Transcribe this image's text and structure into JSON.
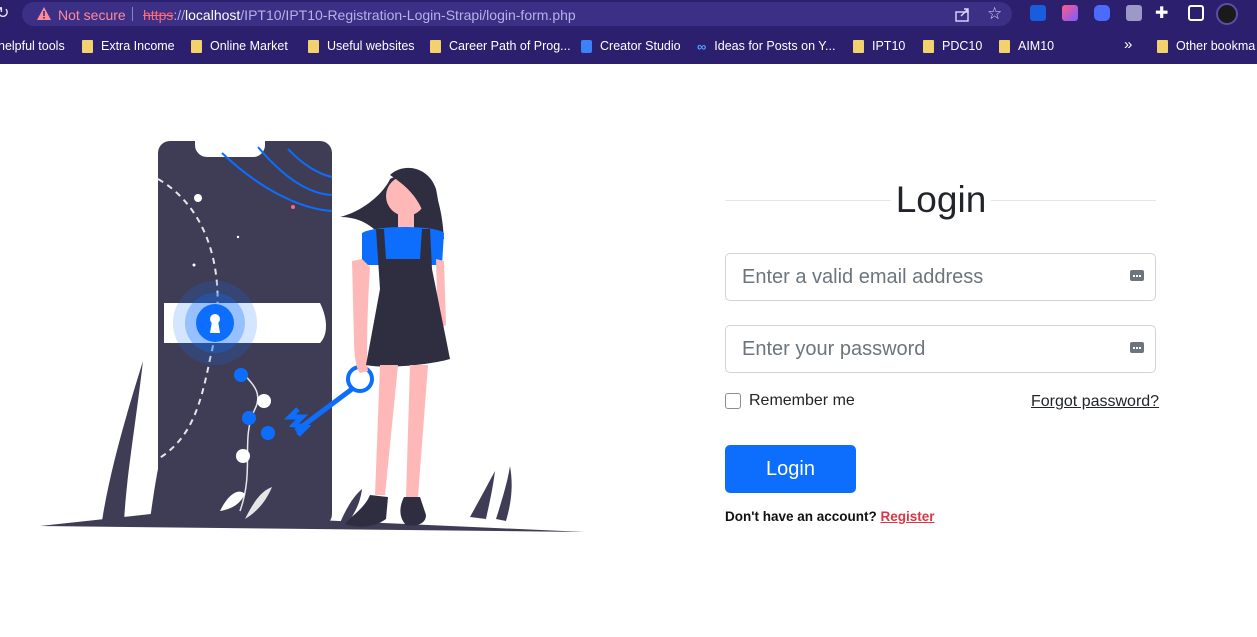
{
  "browser": {
    "security_label": "Not secure",
    "url_scheme": "https",
    "url_sep": "://",
    "url_host": "localhost",
    "url_path": "/IPT10/IPT10-Registration-Login-Strapi/login-form.php"
  },
  "bookmarks": {
    "items": [
      {
        "label": "helpful tools"
      },
      {
        "label": "Extra Income"
      },
      {
        "label": "Online Market"
      },
      {
        "label": "Useful websites"
      },
      {
        "label": "Career Path of Prog..."
      },
      {
        "label": "Creator Studio"
      },
      {
        "label": "Ideas for Posts on Y..."
      },
      {
        "label": "IPT10"
      },
      {
        "label": "PDC10"
      },
      {
        "label": "AIM10"
      }
    ],
    "more": "»",
    "other": "Other bookma"
  },
  "login": {
    "title": "Login",
    "email_placeholder": "Enter a valid email address",
    "password_placeholder": "Enter your password",
    "remember_label": "Remember me",
    "forgot_label": "Forgot password?",
    "submit_label": "Login",
    "no_account_text": "Don't have an account?",
    "register_label": "Register"
  },
  "colors": {
    "browser_bar": "#2b1f6e",
    "primary": "#0d6efd",
    "danger": "#dc3545",
    "illustration_dark": "#3f3d56"
  },
  "icons": {
    "reload": "reload-icon",
    "warning": "warning-icon",
    "share": "share-icon",
    "star": "star-icon",
    "extensions": "puzzle-icon",
    "password_manager": "key-icon"
  }
}
